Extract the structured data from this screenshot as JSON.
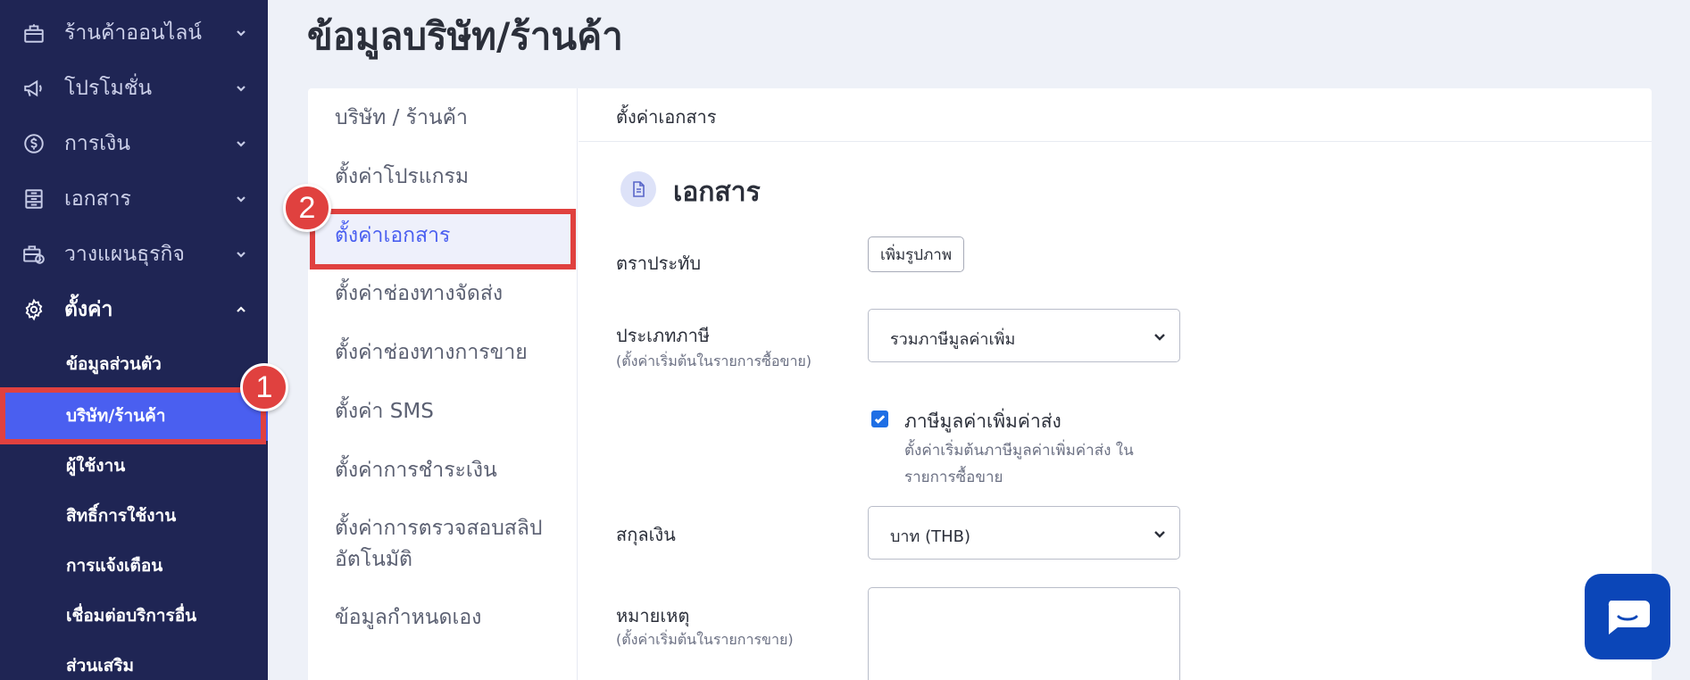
{
  "colors": {
    "sidebar_bg": "#1f2554",
    "active_blue": "#4a5ff0",
    "highlight_red": "#e0413f",
    "checkbox_blue": "#1f6fe5",
    "chat_blue": "#0b46b8"
  },
  "sidebar": {
    "menu": [
      {
        "label": "ร้านค้าออนไลน์",
        "icon": "store-icon"
      },
      {
        "label": "โปรโมชั่น",
        "icon": "megaphone-icon"
      },
      {
        "label": "การเงิน",
        "icon": "dollar-circle-icon"
      },
      {
        "label": "เอกสาร",
        "icon": "document-icon"
      },
      {
        "label": "วางแผนธุรกิจ",
        "icon": "briefcase-clock-icon"
      },
      {
        "label": "ตั้งค่า",
        "icon": "gear-icon"
      }
    ],
    "settings_submenu": [
      "ข้อมูลส่วนตัว",
      "บริษัท/ร้านค้า",
      "ผู้ใช้งาน",
      "สิทธิ์การใช้งาน",
      "การแจ้งเตือน",
      "เชื่อมต่อบริการอื่น",
      "ส่วนเสริม"
    ]
  },
  "callouts": {
    "one": "1",
    "two": "2"
  },
  "page": {
    "title": "ข้อมูลบริษัท/ร้านค้า"
  },
  "settings_nav": {
    "items": [
      "บริษัท / ร้านค้า",
      "ตั้งค่าโปรแกรม",
      "ตั้งค่าเอกสาร",
      "ตั้งค่าช่องทางจัดส่ง",
      "ตั้งค่าช่องทางการขาย",
      "ตั้งค่า SMS",
      "ตั้งค่าการชำระเงิน",
      "ตั้งค่าการตรวจสอบสลิป",
      "อัตโนมัติ",
      "ข้อมูลกำหนดเอง"
    ]
  },
  "content": {
    "header": "ตั้งค่าเอกสาร",
    "section_title": "เอกสาร",
    "stamp": {
      "label": "ตราประทับ",
      "button": "เพิ่มรูปภาพ"
    },
    "tax_type": {
      "label": "ประเภทภาษี",
      "hint": "(ตั้งค่าเริ่มต้นในรายการซื้อขาย)",
      "value": "รวมภาษีมูลค่าเพิ่ม"
    },
    "vat_shipping": {
      "label": "ภาษีมูลค่าเพิ่มค่าส่ง",
      "hint_line1": "ตั้งค่าเริ่มต้นภาษีมูลค่าเพิ่มค่าส่ง ใน",
      "hint_line2": "รายการซื้อขาย",
      "checked": true
    },
    "currency": {
      "label": "สกุลเงิน",
      "value": "บาท (THB)"
    },
    "note": {
      "label": "หมายเหตุ",
      "hint": "(ตั้งค่าเริ่มต้นในรายการขาย)",
      "value": ""
    }
  }
}
